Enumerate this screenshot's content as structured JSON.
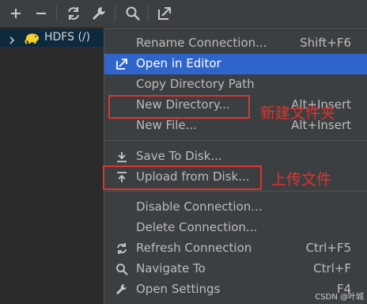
{
  "toolbar": {
    "buttons": [
      {
        "icon": "plus-icon"
      },
      {
        "icon": "minus-icon"
      },
      {
        "icon": "refresh-icon"
      },
      {
        "icon": "wrench-icon"
      },
      {
        "icon": "search-icon"
      },
      {
        "icon": "open-in-editor-icon"
      }
    ]
  },
  "tree": {
    "row_label": "HDFS (/)",
    "icon": "hadoop-elephant-icon",
    "selected_bg": "#0d293e"
  },
  "menu": {
    "items": [
      {
        "label": "Rename Connection...",
        "shortcut": "Shift+F6"
      },
      {
        "label": "Open in Editor",
        "icon": "open-in-editor-icon"
      },
      {
        "label": "Copy Directory Path"
      },
      {
        "label": "New Directory...",
        "shortcut": "Alt+Insert"
      },
      {
        "label": "New File...",
        "shortcut": "Alt+Insert"
      },
      {
        "label": "Save To Disk...",
        "icon": "download-icon"
      },
      {
        "label": "Upload from Disk...",
        "icon": "upload-icon"
      },
      {
        "label": "Disable Connection..."
      },
      {
        "label": "Delete Connection..."
      },
      {
        "label": "Refresh Connection",
        "shortcut": "Ctrl+F5",
        "icon": "refresh-icon"
      },
      {
        "label": "Navigate To",
        "shortcut": "Ctrl+F",
        "icon": "search-icon"
      },
      {
        "label": "Open Settings",
        "shortcut": "F4",
        "icon": "wrench-icon"
      }
    ],
    "selected_color": "#2f65ca"
  },
  "annotations": {
    "new_directory": "新建文件夹",
    "upload": "上传文件",
    "color": "#e0332f"
  },
  "watermark": "CSDN @叶城"
}
